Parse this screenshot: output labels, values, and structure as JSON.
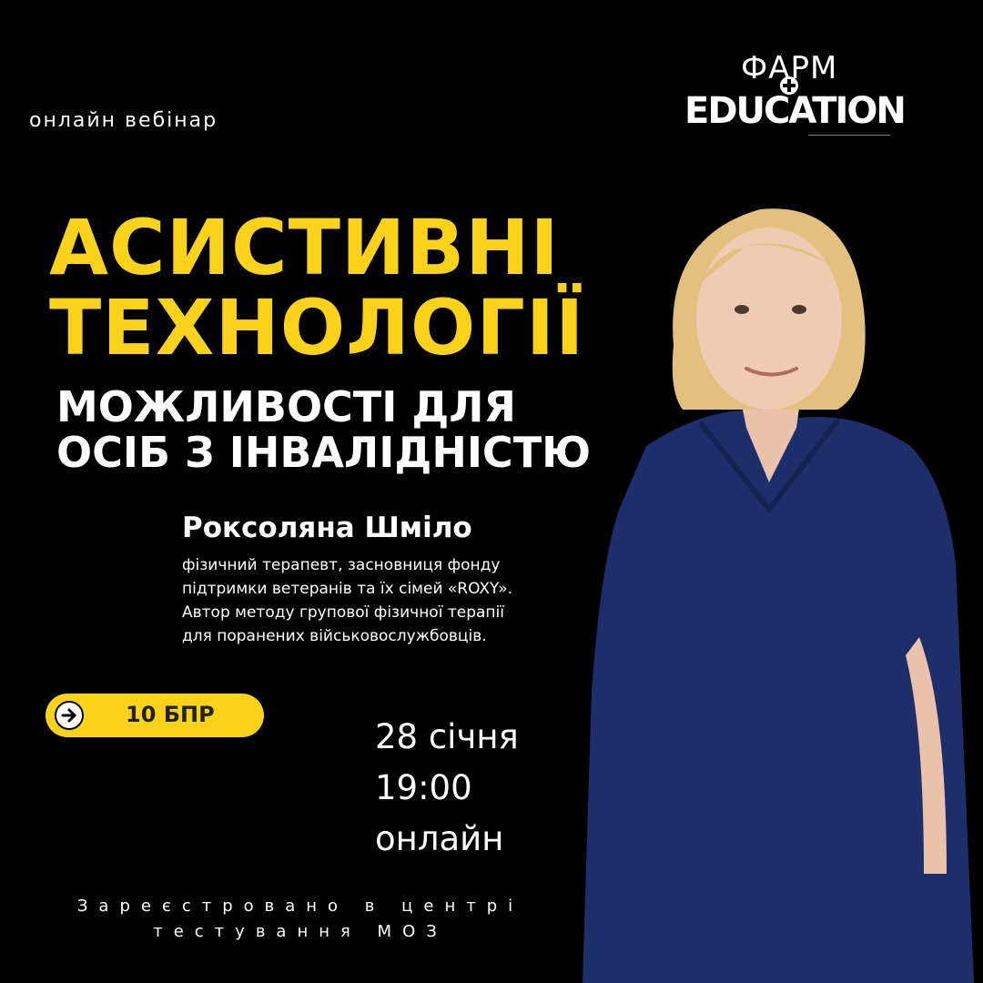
{
  "header": {
    "format_label": "онлайн вебінар"
  },
  "logo": {
    "line1": "ФАРМ",
    "line2": "EDUCATION"
  },
  "title": {
    "line1": "АСИСТИВНІ",
    "line2": "ТЕХНОЛОГІЇ",
    "sub1": "МОЖЛИВОСТІ ДЛЯ",
    "sub2": "ОСІБ З ІНВАЛІДНІСТЮ"
  },
  "speaker": {
    "name": "Роксоляна Шміло",
    "bio_lines": [
      "фізичний терапевт, засновниця фонду",
      "підтримки ветеранів та їх сімей «ROXY».",
      "Автор методу групової фізичної терапії",
      "для поранених військовослужбовців."
    ]
  },
  "badge": {
    "label": "10 БПР",
    "icon": "arrow-right-icon"
  },
  "event": {
    "date": "28 січня",
    "time": "19:00",
    "mode": "онлайн"
  },
  "footer": {
    "line1": "Зареєстровано в центрі",
    "line2": "тестування МОЗ"
  },
  "colors": {
    "accent": "#fbd21a",
    "background": "#000000",
    "scrubs": "#1d2f6b",
    "hair": "#e3c07e"
  }
}
